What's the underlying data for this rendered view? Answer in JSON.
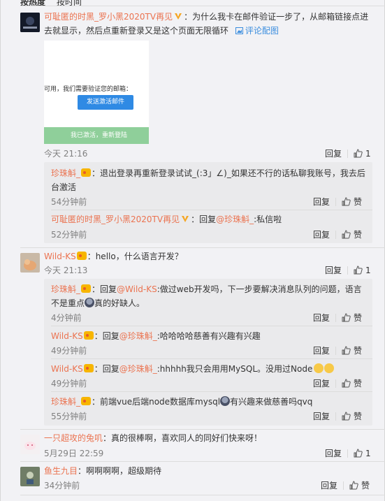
{
  "top_tabs": [
    "按热度",
    "按时间"
  ],
  "comments": [
    {
      "user": "可耻匿的时黑_罗小黑2020TV再见",
      "text": "：为什么我卡在邮件验证一步了，从邮箱链接点进",
      "text2": "去就显示，然后点重新登录又是这个页面无限循环",
      "pic_link": "评论配图",
      "embed": {
        "line": "可用，我们需要验证您的邮箱：",
        "button": "发送激活邮件",
        "bar": "我已激活，重新登陆"
      },
      "time": "今天 21:16",
      "reply": "回复",
      "likes": "1",
      "replies": [
        {
          "user": "珍珠斛_",
          "text": "：退出登录再重新登录试试_(:3」∠)_如果还不行的话私聊我账号，我去后",
          "text2": "台激活",
          "time": "54分钟前",
          "reply": "回复",
          "like": "赞"
        },
        {
          "user": "可耻匿的时黑_罗小黑2020TV再见",
          "prefix": "：回复",
          "mention": "@珍珠斛_",
          "text": ":私信啦",
          "time": "52分钟前",
          "reply": "回复",
          "like": "赞"
        }
      ]
    },
    {
      "user": "Wild-KS",
      "text": "：hello，什么语言开发？",
      "time": "今天 21:13",
      "reply": "回复",
      "likes": "1",
      "replies": [
        {
          "user": "珍珠斛_",
          "prefix": "：回复",
          "mention": "@Wild-KS",
          "text": ":做过web开发吗，下一步要解决消息队列的问题，语言",
          "text2a": "不是重点",
          "text2b": "真的好缺人。",
          "time": "4分钟前",
          "reply": "回复",
          "like": "赞"
        },
        {
          "user": "Wild-KS",
          "prefix": "：回复",
          "mention": "@珍珠斛_",
          "text": ":哈哈哈哈慈善有兴趣有兴趣",
          "time": "49分钟前",
          "reply": "回复",
          "like": "赞"
        },
        {
          "user": "Wild-KS",
          "prefix": "：回复",
          "mention": "@珍珠斛_",
          "text": ":hhhhh我只会用用MySQL。没用过Node",
          "time": "49分钟前",
          "reply": "回复",
          "like": "赞"
        },
        {
          "user": "珍珠斛_",
          "text": "：前端vue后端node数据库mysql",
          "text_b": "有兴趣来做慈善吗qvq",
          "time": "55分钟前",
          "reply": "回复",
          "like": "赞"
        }
      ]
    },
    {
      "user": "一只超攻的兔叽",
      "text": "：真的很棒啊，喜欢同人的同好们快来呀！",
      "time": "5月29日 22:59",
      "reply": "回复",
      "likes": "1"
    },
    {
      "user": "鱼生九目",
      "text": "：啊啊啊啊，超级期待",
      "time": "34分钟前",
      "reply": "回复",
      "like": "赞"
    }
  ],
  "colors": {
    "user": "#eb7350",
    "link": "#3a8dde",
    "meta": "#808080"
  }
}
